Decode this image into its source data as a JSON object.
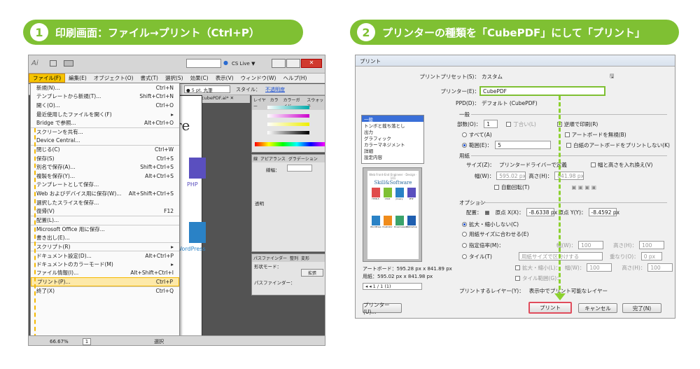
{
  "steps": [
    {
      "num": "1",
      "title": "印刷画面：ファイル→プリント（Ctrl+P）"
    },
    {
      "num": "2",
      "title": "プリンターの種類を「CubePDF」にして「プリント」"
    }
  ],
  "colors": {
    "accent": "#7fc033",
    "highlight": "#f5b800",
    "print_button_frame": "#e04c5c"
  },
  "illustrator": {
    "app_badge": "Ai",
    "cs_live": "CS Live ▼",
    "menubar": [
      "ファイル(F)",
      "編集(E)",
      "オブジェクト(O)",
      "書式(T)",
      "選択(S)",
      "効果(C)",
      "表示(V)",
      "ウィンドウ(W)",
      "ヘルプ(H)"
    ],
    "ctrl": {
      "stroke_style": "● 5 pt. 丸筆",
      "style_label": "スタイル：",
      "opacity": "不透明度"
    },
    "doc_tab": "611116_cubePDF.ai* ✕",
    "panel_tabs": [
      "レイヤー",
      "カラー",
      "カラーガイド",
      "スウォッチ"
    ],
    "panel2_tabs": [
      "線",
      "アピアランス",
      "グラデーション"
    ],
    "stroke_label": "線幅：",
    "transparency": "透明",
    "pathfinder_tabs": [
      "パスファインダー",
      "整列",
      "変形"
    ],
    "shape_mode": "形状モード：",
    "pathfinder_label": "パスファインダー：",
    "expand": "拡張",
    "zoom": "66.67%",
    "page_num": "1",
    "status_sel": "選択",
    "menu_items": [
      {
        "label": "新規(N)...",
        "sc": "Ctrl+N"
      },
      {
        "label": "テンプレートから新規(T)...",
        "sc": "Shift+Ctrl+N"
      },
      {
        "label": "開く(O)...",
        "sc": "Ctrl+O"
      },
      {
        "label": "最近使用したファイルを開く(F)",
        "sc": "▸"
      },
      {
        "label": "Bridge で参照...",
        "sc": "Alt+Ctrl+O"
      },
      {
        "label": "スクリーンを共有...",
        "sc": "",
        "sep": true
      },
      {
        "label": "Device Central...",
        "sc": ""
      },
      {
        "label": "閉じる(C)",
        "sc": "Ctrl+W",
        "sep": true
      },
      {
        "label": "保存(S)",
        "sc": "Ctrl+S"
      },
      {
        "label": "別名で保存(A)...",
        "sc": "Shift+Ctrl+S"
      },
      {
        "label": "複製を保存(Y)...",
        "sc": "Alt+Ctrl+S"
      },
      {
        "label": "テンプレートとして保存...",
        "sc": ""
      },
      {
        "label": "Web およびデバイス用に保存(W)...",
        "sc": "Alt+Shift+Ctrl+S"
      },
      {
        "label": "選択したスライスを保存...",
        "sc": ""
      },
      {
        "label": "復帰(V)",
        "sc": "F12"
      },
      {
        "label": "配置(L)...",
        "sc": "",
        "sep": true
      },
      {
        "label": "Microsoft Office 用に保存...",
        "sc": "",
        "sep": true
      },
      {
        "label": "書き出し(E)...",
        "sc": ""
      },
      {
        "label": "スクリプト(R)",
        "sc": "▸",
        "sep": true
      },
      {
        "label": "ドキュメント設定(D)...",
        "sc": "Alt+Ctrl+P",
        "sep": true
      },
      {
        "label": "ドキュメントのカラーモード(M)",
        "sc": "▸"
      },
      {
        "label": "ファイル情報(I)...",
        "sc": "Alt+Shift+Ctrl+I"
      },
      {
        "label": "プリント(P)...",
        "sc": "Ctrl+P",
        "sep": true,
        "hl": true
      },
      {
        "label": "終了(X)",
        "sc": "Ctrl+Q",
        "sep": true
      }
    ],
    "doc_texts": {
      "brand": "re",
      "php": "PHP",
      "wordpress": "WordPress"
    }
  },
  "print_dialog": {
    "title": "プリント",
    "preset_label": "プリントプリセット(S)：",
    "preset_value": "カスタム",
    "printer_label": "プリンター(E)：",
    "printer_value": "CubePDF",
    "ppd_label": "PPD(D)：",
    "ppd_value": "デフォルト (CubePDF)",
    "left_list": [
      "一般",
      "トンボと裁ち落とし",
      "出力",
      "グラフィック",
      "カラーマネジメント",
      "詳細",
      "設定内容"
    ],
    "preview_title": "Skill&Software",
    "preview_sub": "Web Front-End Engineer · Design · 101",
    "preview_labels": [
      "HTML5",
      "CSS3",
      "jQuery",
      "PHP",
      "WordPress",
      "Illustrator",
      "Dreamweaver",
      "Photoshop"
    ],
    "artboard": "アートボード：595.28 px x 841.89 px",
    "paper": "用紙：595.02 px x 841.98 px",
    "page_nav": "1 / 1 (1)",
    "general": "一般",
    "copies_label": "部数(O)：",
    "copies": "1",
    "collate": "丁合い(L)",
    "reverse": "逆順で印刷(R)",
    "all": "すべて(A)",
    "ignore_artboards": "アートボードを無視(B)",
    "range": "範囲(E)：",
    "range_value": "5",
    "skip_blank": "白紙のアートボードをプリントしない(K)",
    "media": "用紙",
    "size_label": "サイズ(Z)：",
    "size_value": "プリンタードライバーで定義",
    "transverse": "幅と高さを入れ換え(V)",
    "width_label": "幅(W)：",
    "width": "595.02 px",
    "height_label": "高さ(H)：",
    "height": "841.98 px",
    "auto_rotate": "自動回転(T)",
    "options": "オプション",
    "placement": "配置：",
    "origin_x_label": "原点 X(X)：",
    "origin_x": "-8.6338 px",
    "origin_y_label": "原点 Y(Y)：",
    "origin_y": "-8.4592 px",
    "no_scale": "拡大・縮小しない(C)",
    "fit_page": "用紙サイズに合わせる(E)",
    "custom_scale": "指定倍率(M)：",
    "tile": "タイル(T)",
    "tile_range": "用紙サイズで区分けする",
    "overlap_label": "重なり(O)：",
    "overlap": "0 px",
    "scale_label": "拡大・縮小(L)：",
    "w_label": "幅(W)：",
    "h_label": "高さ(H)：",
    "pct": "100",
    "tile_range_label": "タイル範囲(G)：",
    "print_layers_label": "プリントするレイヤー(Y)：",
    "print_layers": "表示中でプリント可能なレイヤー",
    "setup_btn": "プリンター(U)...",
    "print_btn": "プリント",
    "cancel_btn": "キャンセル",
    "done_btn": "完了(N)"
  }
}
